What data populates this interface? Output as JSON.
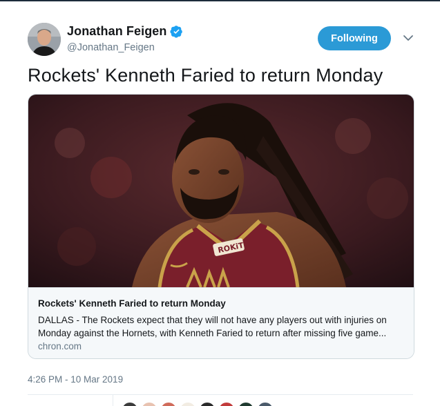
{
  "author": {
    "name": "Jonathan Feigen",
    "handle": "@Jonathan_Feigen",
    "verified": true,
    "avatar_icon": "author-avatar"
  },
  "follow_button": {
    "label": "Following",
    "color": "#2b9ad6"
  },
  "menu": {
    "icon": "chevron-down-icon"
  },
  "tweet": {
    "text": "Rockets' Kenneth Faried to return Monday"
  },
  "card": {
    "image_icon": "basketball-player-photo",
    "title": "Rockets' Kenneth Faried to return Monday",
    "description": "DALLAS - The Rockets expect that they will not have any players out with injuries on Monday against the Hornets, with Kenneth Faried to return after missing five game...",
    "domain": "chron.com",
    "jersey_text": "ROKiT"
  },
  "timestamp": "4:26 PM - 10 Mar 2019",
  "colors": {
    "accent": "#2b9ad6",
    "secondary_text": "#657786",
    "card_background": "#f5f8fa",
    "jersey": "#7a1f2b"
  }
}
